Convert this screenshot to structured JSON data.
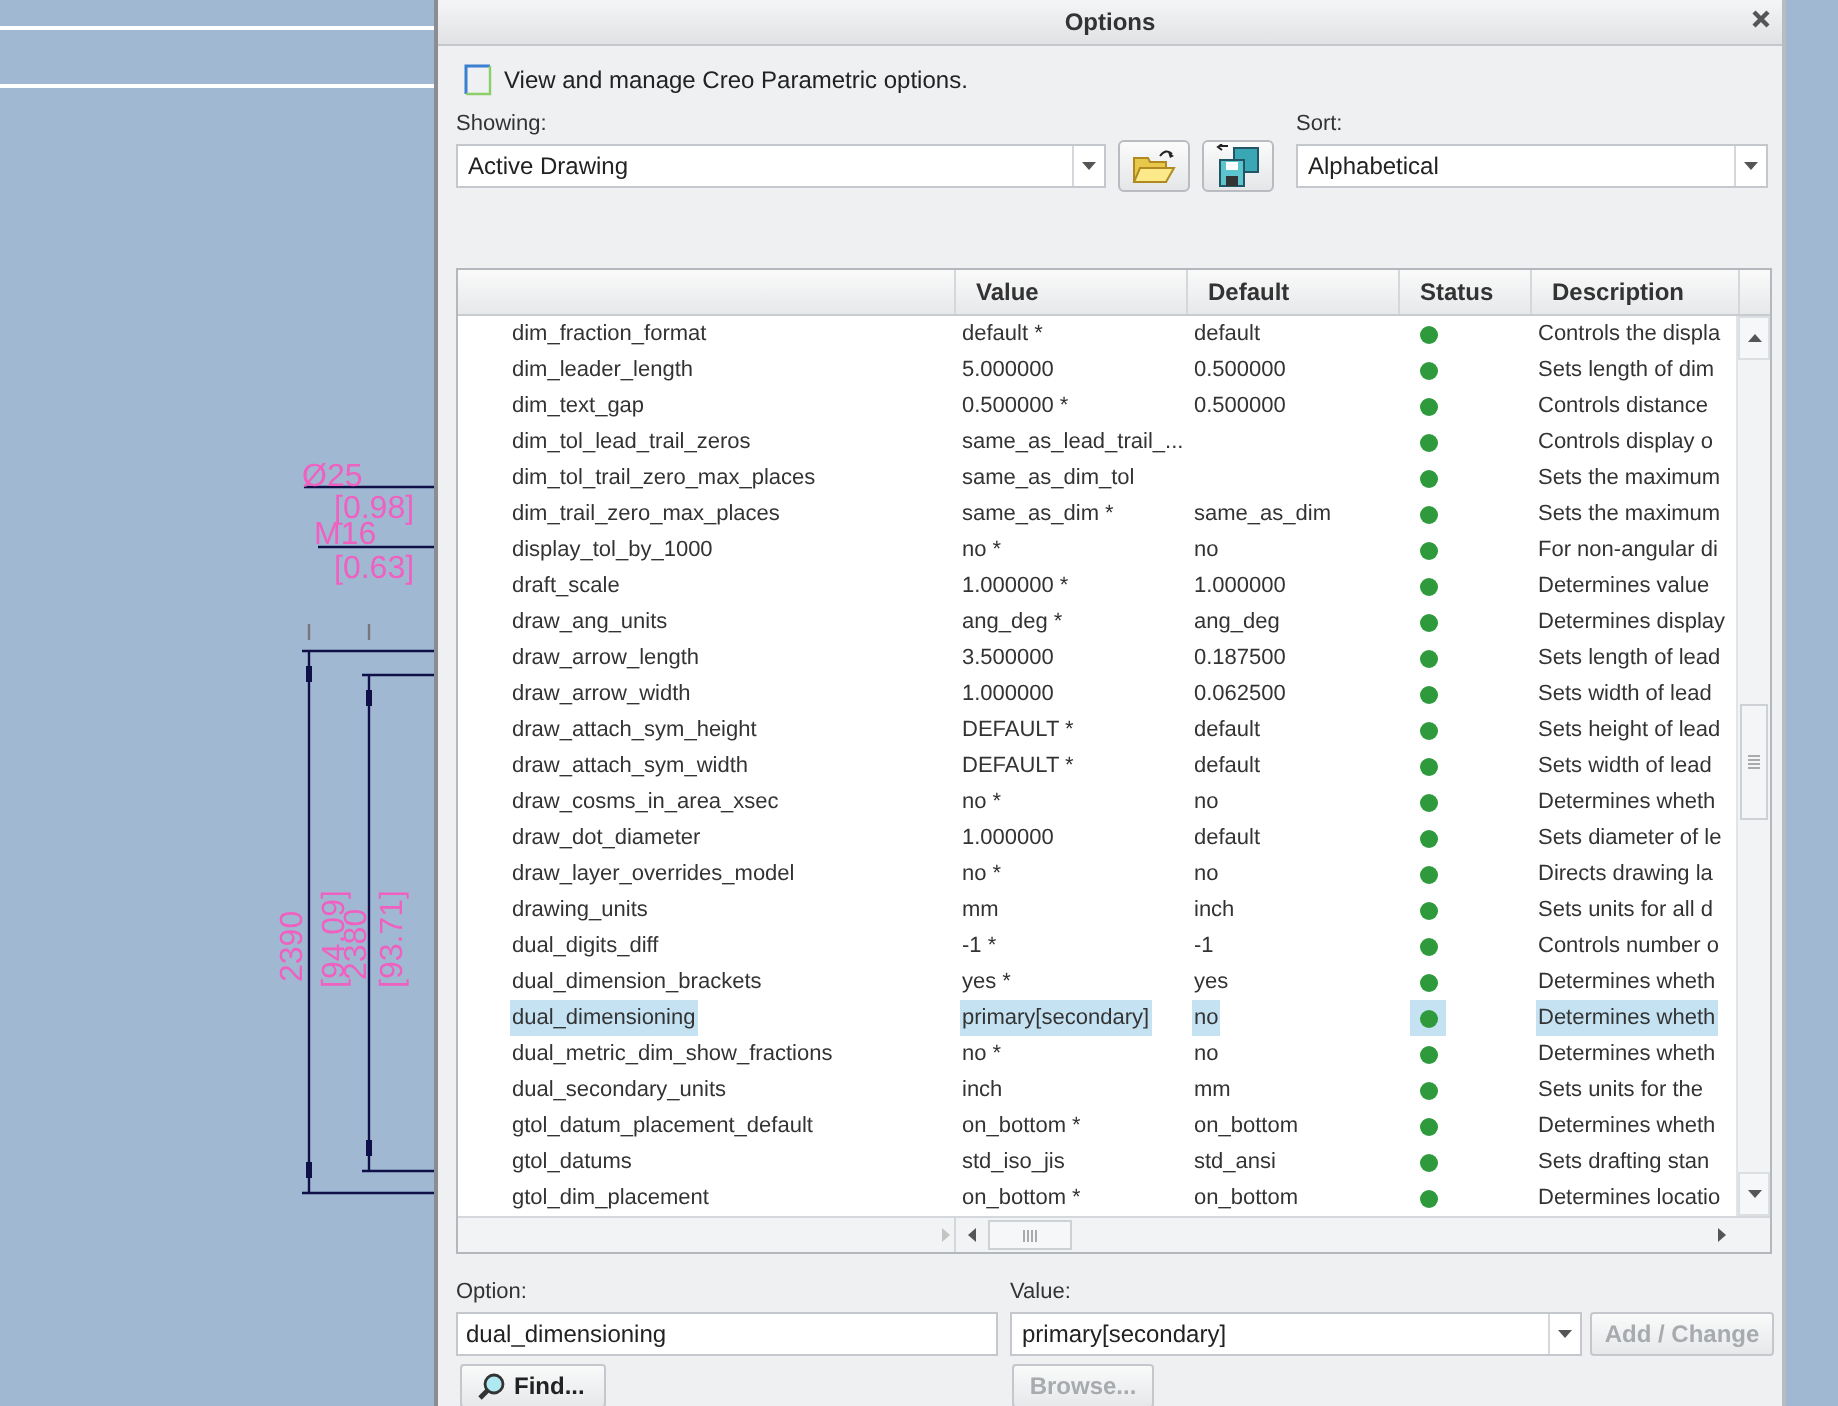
{
  "drawing": {
    "labels": [
      {
        "text": "Ø25"
      },
      {
        "text": "[0.98]"
      },
      {
        "text": "M16"
      },
      {
        "text": "[0.63]"
      },
      {
        "text": "2390"
      },
      {
        "text": "[94.09]"
      },
      {
        "text": "2380"
      },
      {
        "text": "[93.71]"
      }
    ]
  },
  "dialog": {
    "title": "Options",
    "intro": "View and manage Creo Parametric options.",
    "showing": {
      "label": "Showing:",
      "value": "Active Drawing"
    },
    "sort": {
      "label": "Sort:",
      "value": "Alphabetical"
    },
    "table": {
      "columns": [
        "Value",
        "Default",
        "Status",
        "Description"
      ],
      "rows": [
        {
          "name": "dim_fraction_format",
          "value": "default *",
          "default": "default",
          "color": "#2e9a3c",
          "description": "Controls the displa",
          "selected": false
        },
        {
          "name": "dim_leader_length",
          "value": "5.000000",
          "default": "0.500000",
          "color": "#2e9a3c",
          "description": "Sets length of dim",
          "selected": false
        },
        {
          "name": "dim_text_gap",
          "value": "0.500000 *",
          "default": "0.500000",
          "color": "#2e9a3c",
          "description": "Controls distance",
          "selected": false
        },
        {
          "name": "dim_tol_lead_trail_zeros",
          "value": "same_as_lead_trail_...",
          "default": "",
          "color": "#2e9a3c",
          "description": "Controls display o",
          "selected": false
        },
        {
          "name": "dim_tol_trail_zero_max_places",
          "value": "same_as_dim_tol",
          "default": "",
          "color": "#2e9a3c",
          "description": "Sets the maximum",
          "selected": false
        },
        {
          "name": "dim_trail_zero_max_places",
          "value": "same_as_dim *",
          "default": "same_as_dim",
          "color": "#2e9a3c",
          "description": "Sets the maximum",
          "selected": false
        },
        {
          "name": "display_tol_by_1000",
          "value": "no *",
          "default": "no",
          "color": "#2e9a3c",
          "description": "For non-angular di",
          "selected": false
        },
        {
          "name": "draft_scale",
          "value": "1.000000 *",
          "default": "1.000000",
          "color": "#2e9a3c",
          "description": "Determines value",
          "selected": false
        },
        {
          "name": "draw_ang_units",
          "value": "ang_deg *",
          "default": "ang_deg",
          "color": "#2e9a3c",
          "description": "Determines display",
          "selected": false
        },
        {
          "name": "draw_arrow_length",
          "value": "3.500000",
          "default": "0.187500",
          "color": "#2e9a3c",
          "description": "Sets length of lead",
          "selected": false
        },
        {
          "name": "draw_arrow_width",
          "value": "1.000000",
          "default": "0.062500",
          "color": "#2e9a3c",
          "description": "Sets width of lead",
          "selected": false
        },
        {
          "name": "draw_attach_sym_height",
          "value": "DEFAULT *",
          "default": "default",
          "color": "#2e9a3c",
          "description": "Sets height of lead",
          "selected": false
        },
        {
          "name": "draw_attach_sym_width",
          "value": "DEFAULT *",
          "default": "default",
          "color": "#2e9a3c",
          "description": "Sets width of lead",
          "selected": false
        },
        {
          "name": "draw_cosms_in_area_xsec",
          "value": "no *",
          "default": "no",
          "color": "#2e9a3c",
          "description": "Determines wheth",
          "selected": false
        },
        {
          "name": "draw_dot_diameter",
          "value": "1.000000",
          "default": "default",
          "color": "#2e9a3c",
          "description": "Sets diameter of le",
          "selected": false
        },
        {
          "name": "draw_layer_overrides_model",
          "value": "no *",
          "default": "no",
          "color": "#2e9a3c",
          "description": "Directs drawing la",
          "selected": false
        },
        {
          "name": "drawing_units",
          "value": "mm",
          "default": "inch",
          "color": "#2e9a3c",
          "description": "Sets units for all d",
          "selected": false
        },
        {
          "name": "dual_digits_diff",
          "value": "-1 *",
          "default": "-1",
          "color": "#2e9a3c",
          "description": "Controls number o",
          "selected": false
        },
        {
          "name": "dual_dimension_brackets",
          "value": "yes *",
          "default": "yes",
          "color": "#2e9a3c",
          "description": "Determines wheth",
          "selected": false
        },
        {
          "name": "dual_dimensioning",
          "value": "primary[secondary]",
          "default": "no",
          "color": "#2e9a3c",
          "description": "Determines wheth",
          "selected": true
        },
        {
          "name": "dual_metric_dim_show_fractions",
          "value": "no *",
          "default": "no",
          "color": "#2e9a3c",
          "description": "Determines wheth",
          "selected": false
        },
        {
          "name": "dual_secondary_units",
          "value": "inch",
          "default": "mm",
          "color": "#2e9a3c",
          "description": "Sets units for the",
          "selected": false
        },
        {
          "name": "gtol_datum_placement_default",
          "value": "on_bottom *",
          "default": "on_bottom",
          "color": "#2e9a3c",
          "description": "Determines wheth",
          "selected": false
        },
        {
          "name": "gtol_datums",
          "value": "std_iso_jis",
          "default": "std_ansi",
          "color": "#2e9a3c",
          "description": "Sets drafting stan",
          "selected": false
        },
        {
          "name": "gtol_dim_placement",
          "value": "on_bottom *",
          "default": "on_bottom",
          "color": "#2e9a3c",
          "description": "Determines locatio",
          "selected": false
        }
      ]
    },
    "option": {
      "label": "Option:",
      "value": "dual_dimensioning"
    },
    "value": {
      "label": "Value:",
      "value": "primary[secondary]"
    },
    "add_change": {
      "label": "Add / Change",
      "disabled": true
    },
    "find": {
      "label": "Find..."
    },
    "browse": {
      "label": "Browse...",
      "disabled": true
    }
  }
}
